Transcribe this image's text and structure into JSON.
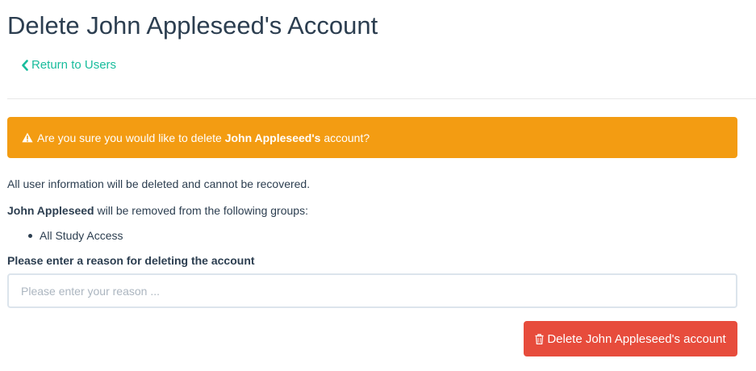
{
  "page": {
    "title": "Delete John Appleseed's Account"
  },
  "nav": {
    "back_label": "Return to Users",
    "back_icon": "chevron-left-icon"
  },
  "alert": {
    "icon": "warning-icon",
    "text_before": "Are you sure you would like to delete ",
    "user_name": "John Appleseed's",
    "text_after": " account?",
    "color": "#f39c12"
  },
  "info": {
    "deletion_notice": "All user information will be deleted and cannot be recovered.",
    "user_name": "John Appleseed",
    "groups_text": " will be removed from the following groups:",
    "groups": [
      "All Study Access"
    ]
  },
  "form": {
    "reason_label": "Please enter a reason for deleting the account",
    "reason_placeholder": "Please enter your reason ...",
    "reason_value": ""
  },
  "actions": {
    "delete_label": "Delete John Appleseed's account",
    "delete_icon": "trash-icon",
    "delete_color": "#e74c3c"
  },
  "colors": {
    "text": "#2c3e50",
    "link": "#18bc9c",
    "input_border": "#dce4ec"
  }
}
